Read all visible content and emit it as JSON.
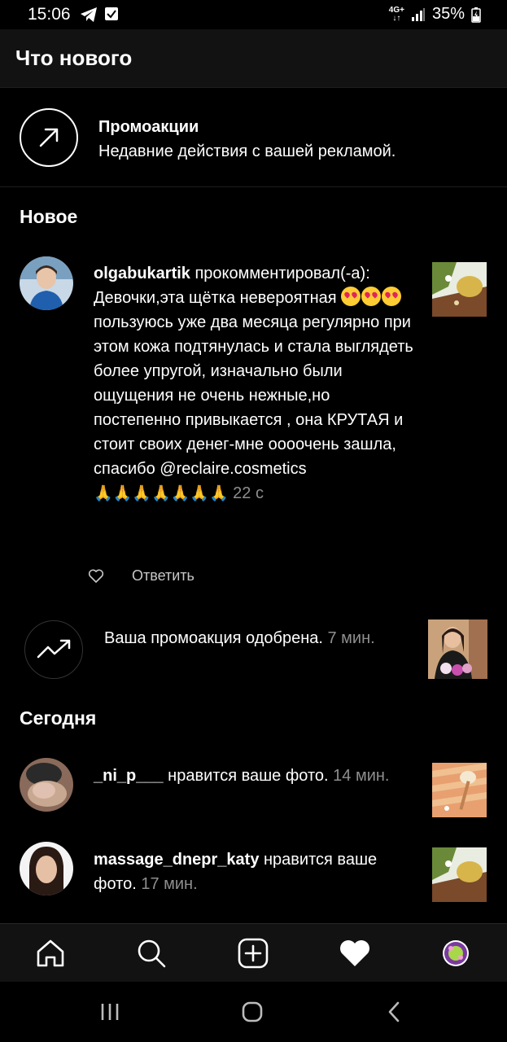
{
  "status": {
    "time": "15:06",
    "network": "4G+",
    "battery": "35%"
  },
  "header": {
    "title": "Что нового"
  },
  "promo": {
    "title": "Промоакции",
    "subtitle": "Недавние действия с вашей рекламой."
  },
  "sections": {
    "new": "Новое",
    "today": "Сегодня"
  },
  "comment": {
    "username": "olgabukartik",
    "action": " прокомментировал(-а):",
    "text_part1": "Девочки,эта щётка невероятная ",
    "text_part2": "пользуюсь уже два месяца регулярно при этом кожа подтянулась и стала выглядеть более упругой, изначально были ощущения не очень нежные,но постепенно привыкается , она КРУТАЯ и стоит своих денег-мне оооочень зашла, спасибо @reclaire.cosmetics ",
    "time": "22 с",
    "reply_label": "Ответить"
  },
  "approved": {
    "text": "Ваша промоакция одобрена.",
    "time": "7 мин."
  },
  "today_items": [
    {
      "username": "_ni_p___",
      "action": " нравится ваше фото.",
      "time": "14 мин."
    },
    {
      "username": "massage_dnepr_katy",
      "action": " нравится ваше фото.",
      "time": "17 мин."
    }
  ],
  "icons": {
    "promo": "arrow-up-right-icon",
    "approved": "trending-up-icon",
    "like": "heart-outline-icon",
    "nav": [
      "home-icon",
      "search-icon",
      "add-post-icon",
      "activity-heart-icon",
      "profile-avatar-icon"
    ]
  }
}
